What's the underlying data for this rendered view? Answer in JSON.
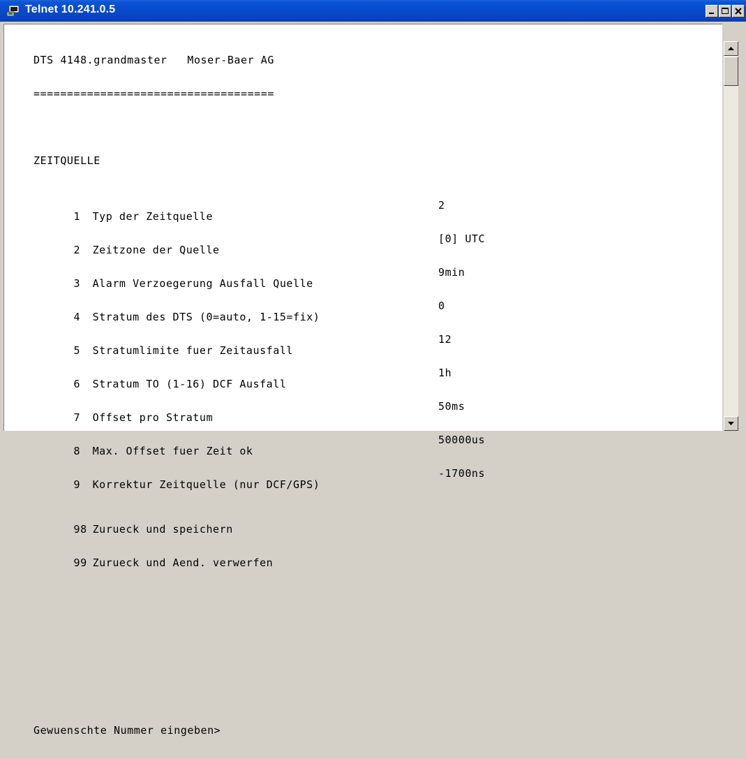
{
  "window": {
    "title": "Telnet 10.241.0.5",
    "title_icon": "telnet-terminal-icon",
    "accent_color": "#0a52d6"
  },
  "terminal": {
    "header": "DTS 4148.grandmaster   Moser-Baer AG",
    "separator": "====================================",
    "section_title": "ZEITQUELLE",
    "rows": [
      {
        "num": "1",
        "label": "Typ der Zeitquelle",
        "value": "2"
      },
      {
        "num": "2",
        "label": "Zeitzone der Quelle",
        "value": "[0] UTC"
      },
      {
        "num": "3",
        "label": "Alarm Verzoegerung Ausfall Quelle",
        "value": "9min"
      },
      {
        "num": "4",
        "label": "Stratum des DTS (0=auto, 1-15=fix)",
        "value": "0"
      },
      {
        "num": "5",
        "label": "Stratumlimite fuer Zeitausfall",
        "value": "12"
      },
      {
        "num": "6",
        "label": "Stratum TO (1-16) DCF Ausfall",
        "value": "1h"
      },
      {
        "num": "7",
        "label": "Offset pro Stratum",
        "value": "50ms"
      },
      {
        "num": "8",
        "label": "Max. Offset fuer Zeit ok",
        "value": "50000us"
      },
      {
        "num": "9",
        "label": "Korrektur Zeitquelle (nur DCF/GPS)",
        "value": "-1700ns"
      }
    ],
    "options": [
      {
        "num": "98",
        "label": "Zurueck und speichern"
      },
      {
        "num": "99",
        "label": "Zurueck und Aend. verwerfen"
      }
    ],
    "prompt": "Gewuenschte Nummer eingeben>"
  },
  "scrollbar": {
    "up_icon": "arrow-up-icon",
    "down_icon": "arrow-down-icon"
  }
}
